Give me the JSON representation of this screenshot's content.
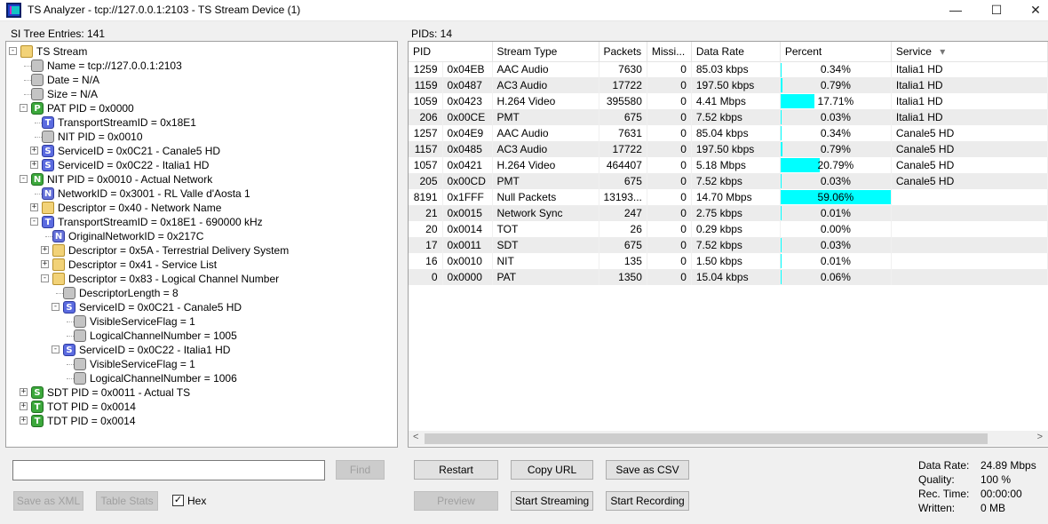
{
  "window": {
    "title": "TS Analyzer - tcp://127.0.0.1:2103 - TS Stream Device (1)",
    "minimize": "—",
    "maximize": "☐",
    "close": "✕"
  },
  "left": {
    "header": "SI Tree Entries: 141"
  },
  "tree": [
    {
      "d": 0,
      "e": "-",
      "i": "folder",
      "t": "TS Stream"
    },
    {
      "d": 1,
      "e": "",
      "i": "gray",
      "t": "Name = tcp://127.0.0.1:2103"
    },
    {
      "d": 1,
      "e": "",
      "i": "gray",
      "t": "Date = N/A"
    },
    {
      "d": 1,
      "e": "",
      "i": "gray",
      "t": "Size = N/A"
    },
    {
      "d": 1,
      "e": "-",
      "i": "P",
      "g": "P",
      "t": "PAT PID = 0x0000"
    },
    {
      "d": 2,
      "e": "",
      "i": "T",
      "g": "T",
      "t": "TransportStreamID = 0x18E1"
    },
    {
      "d": 2,
      "e": "",
      "i": "gray",
      "t": "NIT PID = 0x0010"
    },
    {
      "d": 2,
      "e": "+",
      "i": "S",
      "g": "S",
      "t": "ServiceID = 0x0C21 - Canale5 HD"
    },
    {
      "d": 2,
      "e": "+",
      "i": "S",
      "g": "S",
      "t": "ServiceID = 0x0C22 - Italia1 HD"
    },
    {
      "d": 1,
      "e": "-",
      "i": "P",
      "g": "N",
      "t": "NIT PID = 0x0010 - Actual Network"
    },
    {
      "d": 2,
      "e": "",
      "i": "N",
      "g": "N",
      "t": "NetworkID = 0x3001 - RL Valle d'Aosta 1"
    },
    {
      "d": 2,
      "e": "+",
      "i": "folder",
      "t": "Descriptor = 0x40 - Network Name"
    },
    {
      "d": 2,
      "e": "-",
      "i": "T",
      "g": "T",
      "t": "TransportStreamID = 0x18E1 - 690000 kHz"
    },
    {
      "d": 3,
      "e": "",
      "i": "N",
      "g": "N",
      "t": "OriginalNetworkID = 0x217C"
    },
    {
      "d": 3,
      "e": "+",
      "i": "folder",
      "t": "Descriptor = 0x5A - Terrestrial Delivery System"
    },
    {
      "d": 3,
      "e": "+",
      "i": "folder",
      "t": "Descriptor = 0x41 - Service List"
    },
    {
      "d": 3,
      "e": "-",
      "i": "folder",
      "t": "Descriptor = 0x83 - Logical Channel Number"
    },
    {
      "d": 4,
      "e": "",
      "i": "gray",
      "t": "DescriptorLength = 8"
    },
    {
      "d": 4,
      "e": "-",
      "i": "S",
      "g": "S",
      "t": "ServiceID = 0x0C21 - Canale5 HD"
    },
    {
      "d": 5,
      "e": "",
      "i": "gray",
      "t": "VisibleServiceFlag = 1"
    },
    {
      "d": 5,
      "e": "",
      "i": "gray",
      "t": "LogicalChannelNumber = 1005"
    },
    {
      "d": 4,
      "e": "-",
      "i": "S",
      "g": "S",
      "t": "ServiceID = 0x0C22 - Italia1 HD"
    },
    {
      "d": 5,
      "e": "",
      "i": "gray",
      "t": "VisibleServiceFlag = 1"
    },
    {
      "d": 5,
      "e": "",
      "i": "gray",
      "t": "LogicalChannelNumber = 1006"
    },
    {
      "d": 1,
      "e": "+",
      "i": "P",
      "g": "S",
      "t": "SDT PID = 0x0011 - Actual TS"
    },
    {
      "d": 1,
      "e": "+",
      "i": "P",
      "g": "T",
      "t": "TOT PID = 0x0014"
    },
    {
      "d": 1,
      "e": "+",
      "i": "P",
      "g": "T",
      "t": "TDT PID = 0x0014"
    }
  ],
  "right": {
    "header": "PIDs: 14"
  },
  "table": {
    "columns": [
      "PID",
      "Stream Type",
      "Packets",
      "Missi...",
      "Data Rate",
      "Percent",
      "Service"
    ],
    "sort_indicator": "▾",
    "rows": [
      {
        "pid": "1259",
        "hex": "0x04EB",
        "type": "AAC Audio",
        "packets": "7630",
        "missing": "0",
        "rate": "85.03 kbps",
        "pct": "0.34%",
        "pv": 0.34,
        "service": "Italia1 HD"
      },
      {
        "pid": "1159",
        "hex": "0x0487",
        "type": "AC3 Audio",
        "packets": "17722",
        "missing": "0",
        "rate": "197.50 kbps",
        "pct": "0.79%",
        "pv": 0.79,
        "service": "Italia1 HD"
      },
      {
        "pid": "1059",
        "hex": "0x0423",
        "type": "H.264 Video",
        "packets": "395580",
        "missing": "0",
        "rate": "4.41 Mbps",
        "pct": "17.71%",
        "pv": 17.71,
        "service": "Italia1 HD"
      },
      {
        "pid": "206",
        "hex": "0x00CE",
        "type": "PMT",
        "packets": "675",
        "missing": "0",
        "rate": "7.52 kbps",
        "pct": "0.03%",
        "pv": 0.03,
        "service": "Italia1 HD"
      },
      {
        "pid": "1257",
        "hex": "0x04E9",
        "type": "AAC Audio",
        "packets": "7631",
        "missing": "0",
        "rate": "85.04 kbps",
        "pct": "0.34%",
        "pv": 0.34,
        "service": "Canale5 HD"
      },
      {
        "pid": "1157",
        "hex": "0x0485",
        "type": "AC3 Audio",
        "packets": "17722",
        "missing": "0",
        "rate": "197.50 kbps",
        "pct": "0.79%",
        "pv": 0.79,
        "service": "Canale5 HD"
      },
      {
        "pid": "1057",
        "hex": "0x0421",
        "type": "H.264 Video",
        "packets": "464407",
        "missing": "0",
        "rate": "5.18 Mbps",
        "pct": "20.79%",
        "pv": 20.79,
        "service": "Canale5 HD"
      },
      {
        "pid": "205",
        "hex": "0x00CD",
        "type": "PMT",
        "packets": "675",
        "missing": "0",
        "rate": "7.52 kbps",
        "pct": "0.03%",
        "pv": 0.03,
        "service": "Canale5 HD"
      },
      {
        "pid": "8191",
        "hex": "0x1FFF",
        "type": "Null Packets",
        "packets": "13193...",
        "missing": "0",
        "rate": "14.70 Mbps",
        "pct": "59.06%",
        "pv": 59.06,
        "service": ""
      },
      {
        "pid": "21",
        "hex": "0x0015",
        "type": "Network Sync",
        "packets": "247",
        "missing": "0",
        "rate": "2.75 kbps",
        "pct": "0.01%",
        "pv": 0.01,
        "service": ""
      },
      {
        "pid": "20",
        "hex": "0x0014",
        "type": "TOT",
        "packets": "26",
        "missing": "0",
        "rate": "0.29 kbps",
        "pct": "0.00%",
        "pv": 0,
        "service": ""
      },
      {
        "pid": "17",
        "hex": "0x0011",
        "type": "SDT",
        "packets": "675",
        "missing": "0",
        "rate": "7.52 kbps",
        "pct": "0.03%",
        "pv": 0.03,
        "service": ""
      },
      {
        "pid": "16",
        "hex": "0x0010",
        "type": "NIT",
        "packets": "135",
        "missing": "0",
        "rate": "1.50 kbps",
        "pct": "0.01%",
        "pv": 0.01,
        "service": ""
      },
      {
        "pid": "0",
        "hex": "0x0000",
        "type": "PAT",
        "packets": "1350",
        "missing": "0",
        "rate": "15.04 kbps",
        "pct": "0.06%",
        "pv": 0.06,
        "service": ""
      }
    ]
  },
  "scroll": {
    "left": "<",
    "right": ">"
  },
  "search": {
    "value": "",
    "find": "Find"
  },
  "buttons": {
    "save_xml": "Save as XML",
    "table_stats": "Table Stats",
    "hex": "Hex",
    "hex_checked": "✓",
    "restart": "Restart",
    "copy_url": "Copy URL",
    "save_csv": "Save as CSV",
    "preview": "Preview",
    "start_streaming": "Start Streaming",
    "start_recording": "Start Recording"
  },
  "stats": {
    "rate_label": "Data Rate:",
    "rate": "24.89 Mbps",
    "quality_label": "Quality:",
    "quality": "100 %",
    "rec_label": "Rec. Time:",
    "rec": "00:00:00",
    "written_label": "Written:",
    "written": "0 MB"
  },
  "colors": {
    "percent_bar": "#00ffff",
    "window_bg": "#f0f0f0"
  }
}
